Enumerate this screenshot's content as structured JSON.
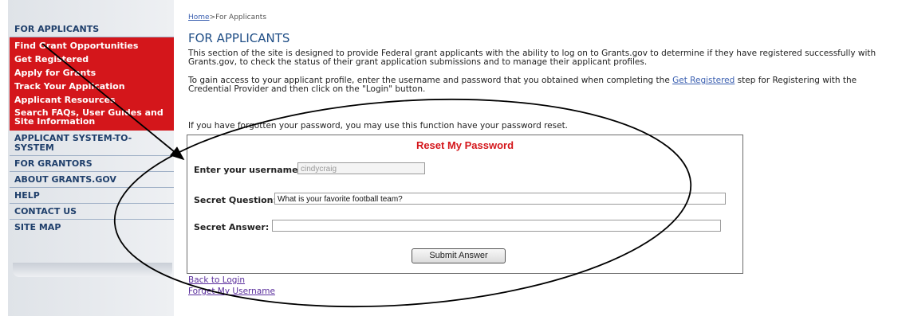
{
  "sidebar": {
    "section_title": "FOR APPLICANTS",
    "red_items": [
      "Find Grant Opportunities",
      "Get Registered",
      "Apply for Grants",
      "Track Your Application",
      "Applicant Resources",
      "Search FAQs, User Guides and Site Information"
    ],
    "blue_items": [
      "APPLICANT SYSTEM-TO-SYSTEM",
      "FOR GRANTORS",
      "ABOUT GRANTS.GOV",
      "HELP",
      "CONTACT US",
      "SITE MAP"
    ]
  },
  "breadcrumb": {
    "home": "Home",
    "separator": ">",
    "current": "For Applicants"
  },
  "page": {
    "title": "FOR APPLICANTS",
    "intro": "This section of the site is designed to provide Federal grant applicants with the ability to log on to Grants.gov to determine if they have registered successfully with Grants.gov, to check the status of their grant application submissions and to manage their applicant profiles.",
    "access_pre": "To gain access to your applicant profile, enter the username and password that you obtained when completing the ",
    "access_link": "Get Registered",
    "access_post": " step for Registering with the Credential Provider and then click on the \"Login\" button.",
    "forgot": "If you have forgotten your password, you may use this function have your password reset."
  },
  "reset": {
    "title": "Reset My Password",
    "username_label": "Enter your username:",
    "username_value": "cindycraig",
    "question_label": "Secret Question:",
    "question_value": "What is your favorite football team?",
    "answer_label": "Secret Answer:",
    "answer_value": "",
    "submit_label": "Submit Answer"
  },
  "links": {
    "back": "Back to Login",
    "forget_username": "Forget My Username"
  },
  "colors": {
    "nav_red": "#d4161b",
    "nav_blue_text": "#1f3f6b",
    "title_blue": "#1f4e86"
  }
}
